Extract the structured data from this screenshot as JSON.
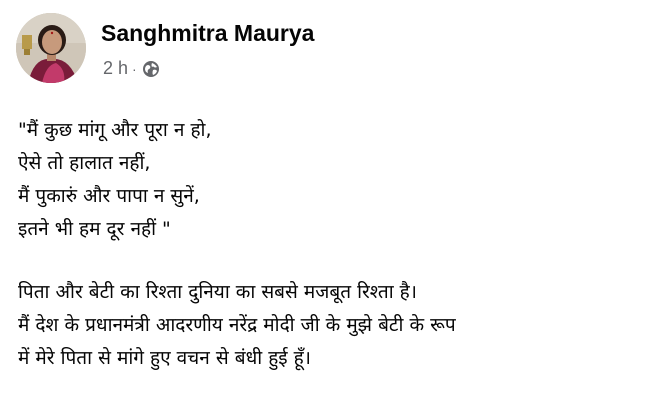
{
  "post": {
    "author": "Sanghmitra Maurya",
    "time": "2 h",
    "separator": "·",
    "audience_icon": "globe-icon",
    "poem": [
      "\"मैं कुछ मांगू और पूरा न हो,",
      "ऐसे तो हालात नहीं,",
      "मैं पुकारुं और पापा न सुनें,",
      "इतने भी हम दूर नहीं \""
    ],
    "paragraph": [
      "पिता और बेटी का रिश्ता दुनिया का सबसे मजबूत रिश्ता है।",
      "मैं देश के प्रधानमंत्री आदरणीय नरेंद्र मोदी जी के मुझे बेटी के रूप",
      "में मेरे पिता से मांगे हुए वचन से बंधी हुई हूँ।"
    ]
  }
}
